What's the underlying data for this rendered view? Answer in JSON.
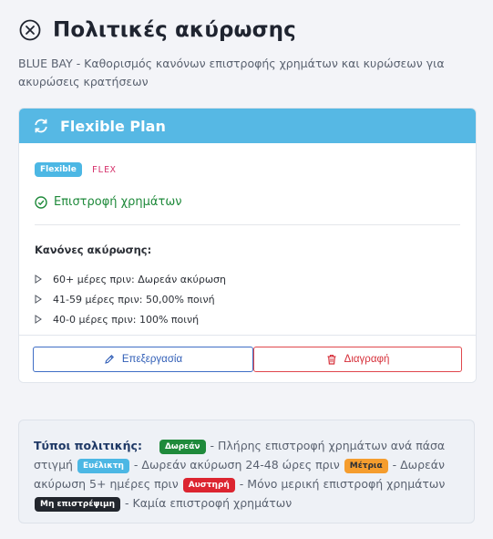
{
  "header": {
    "title": "Πολιτικές ακύρωσης",
    "subtitle": "BLUE BAY - Καθορισμός κανόνων επιστροφής χρημάτων και κυρώσεων για ακυρώσεις κρατήσεων"
  },
  "plan": {
    "title": "Flexible Plan",
    "badge": "Flexible",
    "code": "FLEX",
    "refund_label": "Επιστροφή χρημάτων",
    "rules_title": "Κανόνες ακύρωσης:",
    "rules": [
      "60+ μέρες πριν: Δωρεάν ακύρωση",
      "41-59 μέρες πριν: 50,00% ποινή",
      "40-0 μέρες πριν: 100% ποινή"
    ],
    "edit_label": "Επεξεργασία",
    "delete_label": "Διαγραφή"
  },
  "legend": {
    "title": "Τύποι πολιτικής:",
    "items": [
      {
        "badge": "Δωρεάν",
        "text": "- Πλήρης επιστροφή χρημάτων ανά πάσα στιγμή",
        "color": "#1f8a3b"
      },
      {
        "badge": "Ευέλικτη",
        "text": "- Δωρεάν ακύρωση 24-48 ώρες πριν",
        "color": "#4cb7e4"
      },
      {
        "badge": "Μέτρια",
        "text": "- Δωρεάν ακύρωση 5+ ημέρες πριν",
        "color": "#f59d2e"
      },
      {
        "badge": "Αυστηρή",
        "text": "- Μόνο μερική επιστροφή χρημάτων",
        "color": "#dc2530"
      },
      {
        "badge": "Μη επιστρέψιμη",
        "text": "- Καμία επιστροφή χρημάτων",
        "color": "#22262d"
      }
    ]
  },
  "colors": {
    "header_blue": "#56b8e4",
    "success_green": "#1f8a3b",
    "danger_red": "#dc2530",
    "primary_blue": "#2f5db6"
  }
}
